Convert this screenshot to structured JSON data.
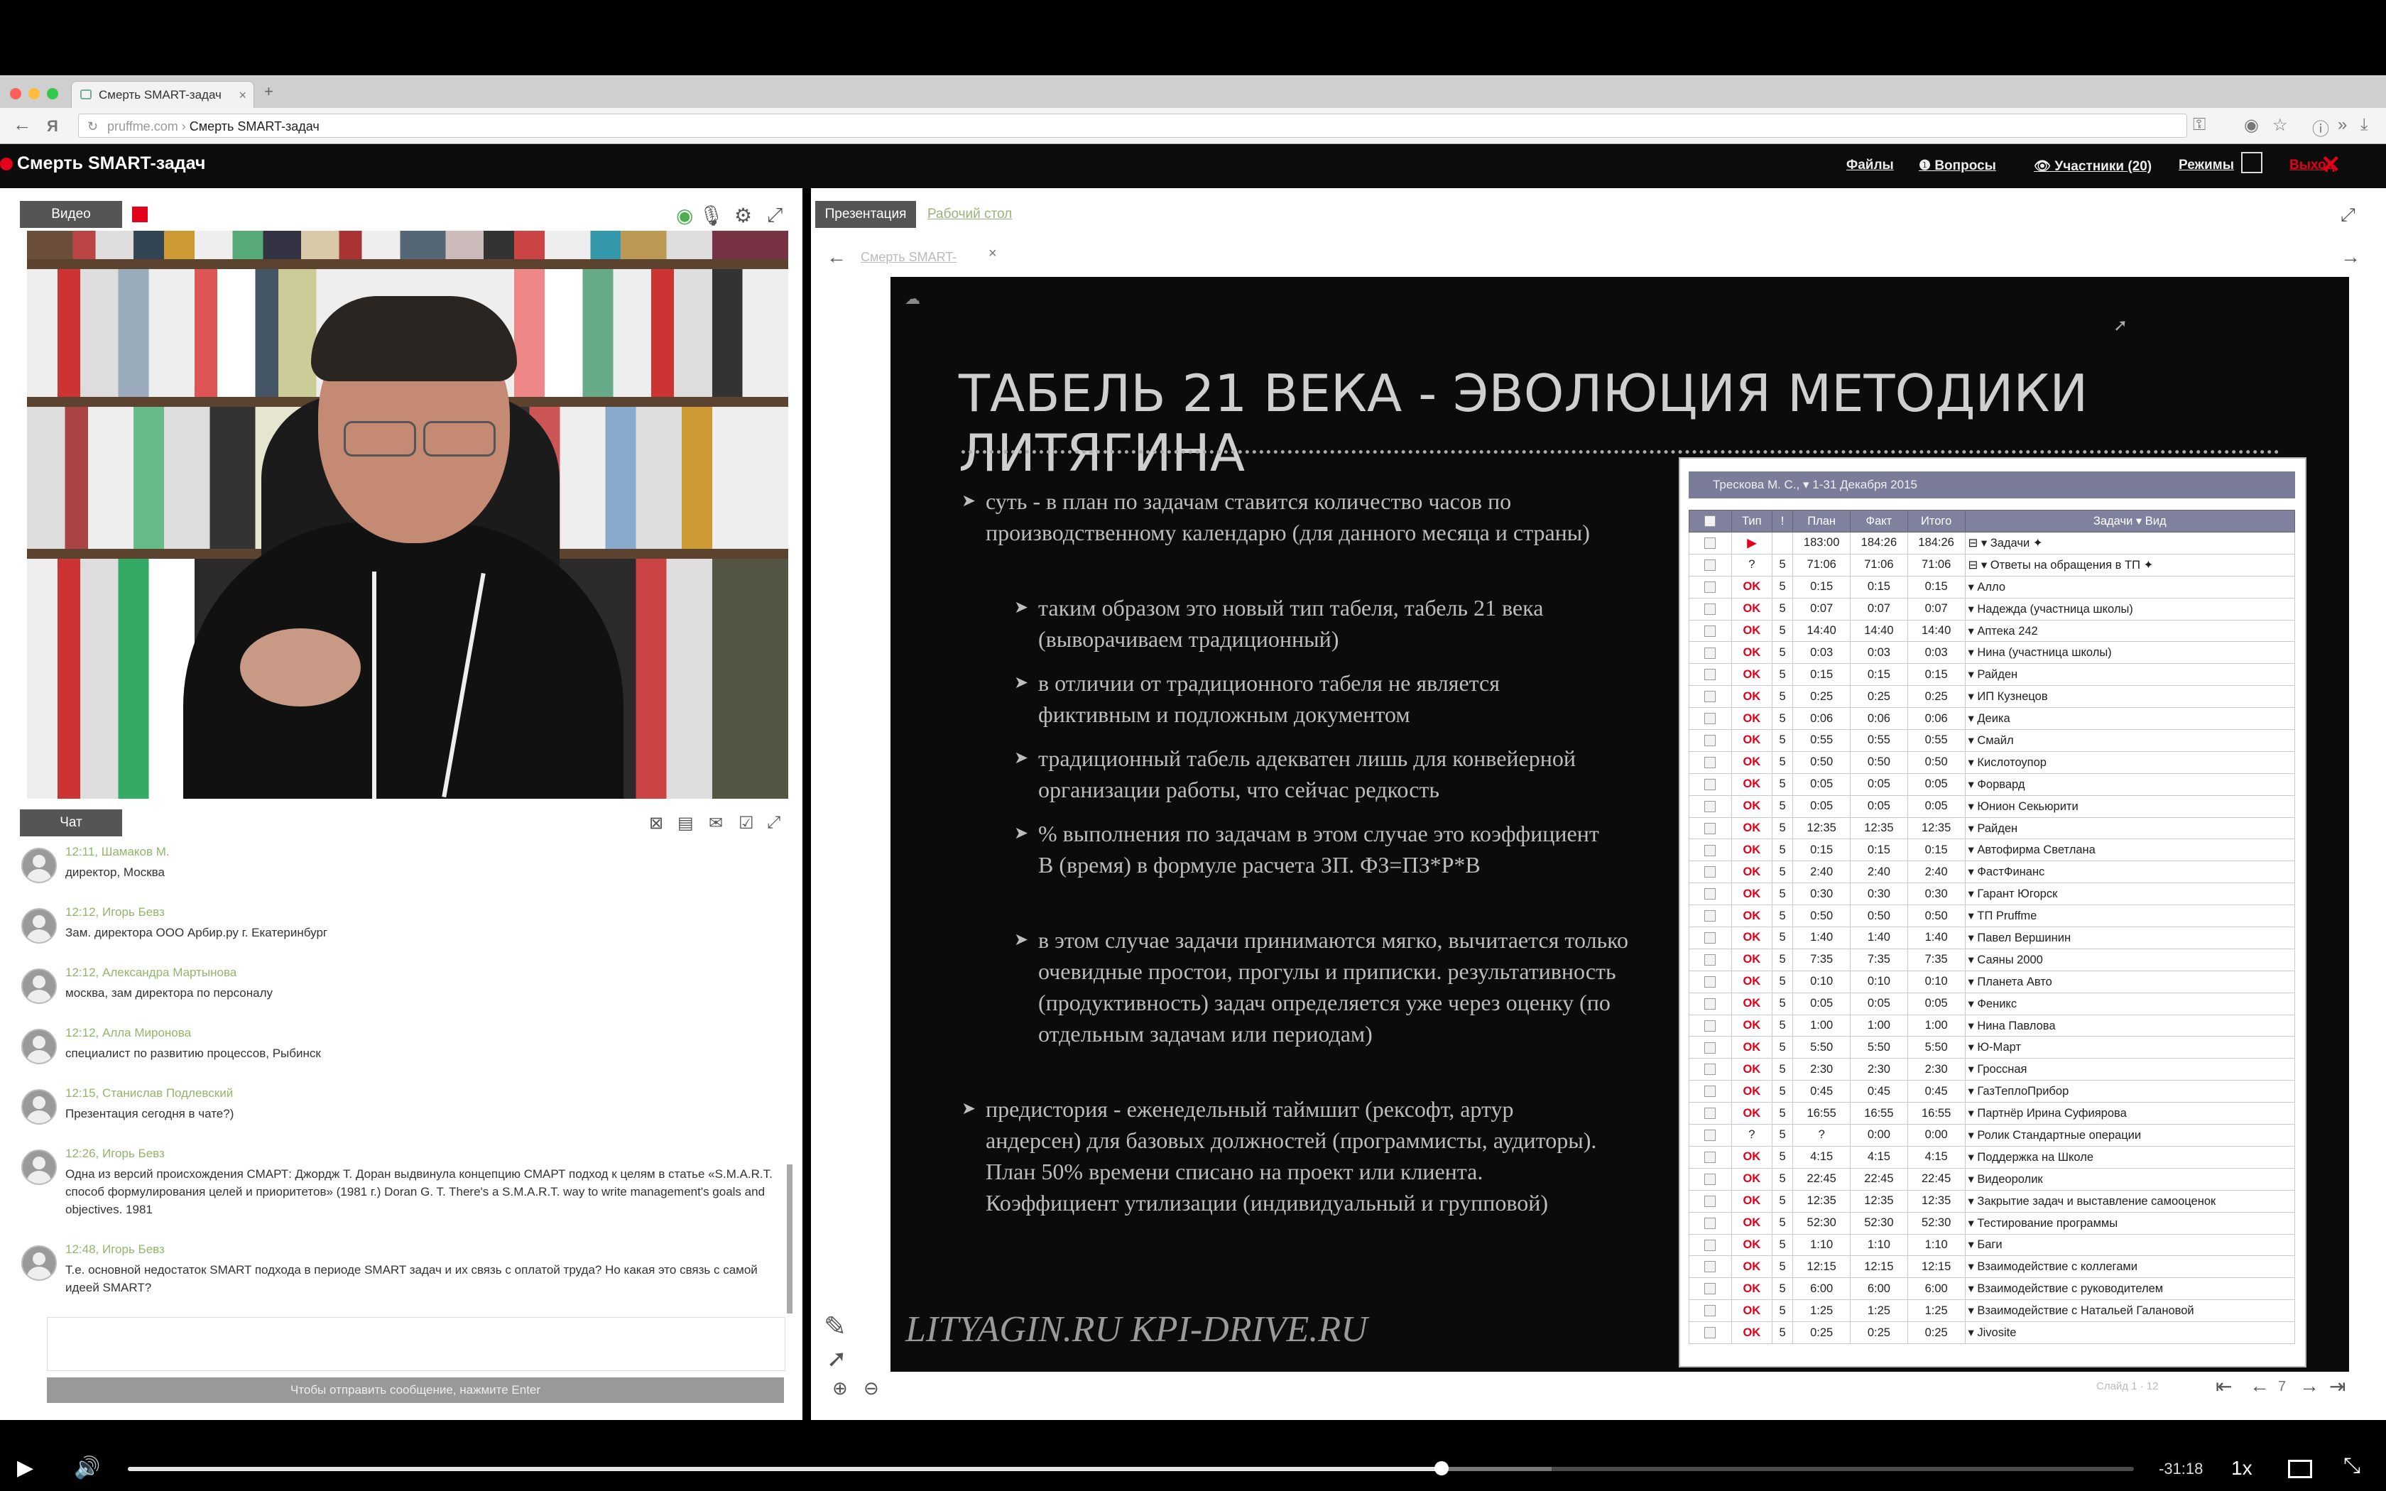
{
  "browser": {
    "tab_title": "Смерть SMART-задач",
    "url_host": "pruffme.com",
    "url_sep": " › ",
    "url_path": "Смерть SMART-задач"
  },
  "app": {
    "title": "Смерть SMART-задач",
    "header_links": [
      "Файлы",
      "Вопросы",
      "Участники (20)",
      "Режимы"
    ],
    "leave_label": "Выход"
  },
  "left": {
    "video_tab": "Видео",
    "chat_tab": "Чат",
    "messages": [
      {
        "time": "12:11",
        "author": "Шамаков М.",
        "text": "директор, Москва"
      },
      {
        "time": "12:12",
        "author": "Игорь Бевз",
        "text": "Зам. директора ООО Арбир.ру г. Екатеринбург"
      },
      {
        "time": "12:12",
        "author": "Александра Мартынова",
        "text": "москва, зам директора по персоналу"
      },
      {
        "time": "12:12",
        "author": "Алла Миронова",
        "text": "специалист по развитию процессов, Рыбинск"
      },
      {
        "time": "12:15",
        "author": "Станислав Подлевский",
        "text": "Презентация сегодня в чате?)"
      },
      {
        "time": "12:26",
        "author": "Игорь Бевз",
        "text": "Одна из версий происхождения СМАРТ: Джордж Т. Доран выдвинула концепцию СМАРТ подход к целям в статье «S.M.A.R.T. способ формулирования целей и приоритетов» (1981 г.) Doran G. T. There's a S.M.A.R.T. way to write management's goals and objectives. 1981"
      },
      {
        "time": "12:48",
        "author": "Игорь Бевз",
        "text": "Т.е. основной недостаток SMART подхода в периоде SMART задач и их связь с оплатой труда? Но какая это связь с самой идеей SMART?"
      }
    ],
    "send_hint": "Чтобы отправить сообщение, нажмите Enter"
  },
  "right": {
    "tab_presentation": "Презентация",
    "tab_desktop": "Рабочий стол",
    "doc_tab": "Смерть SMART-",
    "slide_counter": "Слайд 1 · 12",
    "page_num": "7"
  },
  "slide": {
    "title": "ТАБЕЛЬ 21 ВЕКА - ЭВОЛЮЦИЯ МЕТОДИКИ ЛИТЯГИНА",
    "bullet1": "суть - в план по задачам ставится количество часов по производственному календарю (для данного месяца и страны)",
    "sub1": "таким образом это новый тип табеля, табель 21 века (выворачиваем традиционный)",
    "sub2": "в отличии от традиционного табеля не является фиктивным и подложным документом",
    "sub3": "традиционный табель адекватен лишь для конвейерной организации работы, что сейчас редкость",
    "sub4": "% выполнения по задачам в этом случае это коэффициент В (время) в формуле расчета ЗП. ФЗ=ПЗ*Р*В",
    "sub5": "в этом случае задачи принимаются мягко, вычитается только очевидные простои, прогулы и приписки. результативность (продуктивность) задач определяется уже через оценку (по отдельным задачам или периодам)",
    "bullet2": "предистория - еженедельный таймшит (рексофт, артур андерсен) для базовых должностей (программисты, аудиторы). План 50% времени списано на проект или клиента. Коэффициент утилизации (индивидуальный и групповой)",
    "footer": "LITYAGIN.RU  KPI-DRIVE.RU",
    "table": {
      "header": "Трескова М. С.,  ▾  1-31 Декабря 2015",
      "columns": [
        "",
        "Тип",
        "!",
        "План",
        "Факт",
        "Итого",
        "Задачи  ▾ Вид"
      ],
      "rows": [
        {
          "type": "▶",
          "imp": "",
          "plan": "183:00",
          "fact": "184:26",
          "total": "184:26",
          "name": "⊟ ▾ Задачи ✦"
        },
        {
          "type": "?",
          "imp": "5",
          "plan": "71:06",
          "fact": "71:06",
          "total": "71:06",
          "name": "⊟ ▾ Ответы на обращения в ТП ✦"
        },
        {
          "type": "OK",
          "imp": "5",
          "plan": "0:15",
          "fact": "0:15",
          "total": "0:15",
          "name": "▾ Алло"
        },
        {
          "type": "OK",
          "imp": "5",
          "plan": "0:07",
          "fact": "0:07",
          "total": "0:07",
          "name": "▾ Надежда (участница школы)"
        },
        {
          "type": "OK",
          "imp": "5",
          "plan": "14:40",
          "fact": "14:40",
          "total": "14:40",
          "name": "▾ Аптека 242"
        },
        {
          "type": "OK",
          "imp": "5",
          "plan": "0:03",
          "fact": "0:03",
          "total": "0:03",
          "name": "▾ Нина (участница школы)"
        },
        {
          "type": "OK",
          "imp": "5",
          "plan": "0:15",
          "fact": "0:15",
          "total": "0:15",
          "name": "▾ Райден"
        },
        {
          "type": "OK",
          "imp": "5",
          "plan": "0:25",
          "fact": "0:25",
          "total": "0:25",
          "name": "▾ ИП Кузнецов"
        },
        {
          "type": "OK",
          "imp": "5",
          "plan": "0:06",
          "fact": "0:06",
          "total": "0:06",
          "name": "▾ Деика"
        },
        {
          "type": "OK",
          "imp": "5",
          "plan": "0:55",
          "fact": "0:55",
          "total": "0:55",
          "name": "▾ Смайл"
        },
        {
          "type": "OK",
          "imp": "5",
          "plan": "0:50",
          "fact": "0:50",
          "total": "0:50",
          "name": "▾ Кислотоупор"
        },
        {
          "type": "OK",
          "imp": "5",
          "plan": "0:05",
          "fact": "0:05",
          "total": "0:05",
          "name": "▾ Форвард"
        },
        {
          "type": "OK",
          "imp": "5",
          "plan": "0:05",
          "fact": "0:05",
          "total": "0:05",
          "name": "▾ Юнион Секьюрити"
        },
        {
          "type": "OK",
          "imp": "5",
          "plan": "12:35",
          "fact": "12:35",
          "total": "12:35",
          "name": "▾ Райден"
        },
        {
          "type": "OK",
          "imp": "5",
          "plan": "0:15",
          "fact": "0:15",
          "total": "0:15",
          "name": "▾ Автофирма Светлана"
        },
        {
          "type": "OK",
          "imp": "5",
          "plan": "2:40",
          "fact": "2:40",
          "total": "2:40",
          "name": "▾ ФастФинанс"
        },
        {
          "type": "OK",
          "imp": "5",
          "plan": "0:30",
          "fact": "0:30",
          "total": "0:30",
          "name": "▾ Гарант Югорск"
        },
        {
          "type": "OK",
          "imp": "5",
          "plan": "0:50",
          "fact": "0:50",
          "total": "0:50",
          "name": "▾ ТП Pruffme"
        },
        {
          "type": "OK",
          "imp": "5",
          "plan": "1:40",
          "fact": "1:40",
          "total": "1:40",
          "name": "▾ Павел Вершинин"
        },
        {
          "type": "OK",
          "imp": "5",
          "plan": "7:35",
          "fact": "7:35",
          "total": "7:35",
          "name": "▾ Саяны 2000"
        },
        {
          "type": "OK",
          "imp": "5",
          "plan": "0:10",
          "fact": "0:10",
          "total": "0:10",
          "name": "▾ Планета Авто"
        },
        {
          "type": "OK",
          "imp": "5",
          "plan": "0:05",
          "fact": "0:05",
          "total": "0:05",
          "name": "▾ Феникс"
        },
        {
          "type": "OK",
          "imp": "5",
          "plan": "1:00",
          "fact": "1:00",
          "total": "1:00",
          "name": "▾ Нина Павлова"
        },
        {
          "type": "OK",
          "imp": "5",
          "plan": "5:50",
          "fact": "5:50",
          "total": "5:50",
          "name": "▾ Ю-Март"
        },
        {
          "type": "OK",
          "imp": "5",
          "plan": "2:30",
          "fact": "2:30",
          "total": "2:30",
          "name": "▾ Гроссная"
        },
        {
          "type": "OK",
          "imp": "5",
          "plan": "0:45",
          "fact": "0:45",
          "total": "0:45",
          "name": "▾ ГазТеплоПрибор"
        },
        {
          "type": "OK",
          "imp": "5",
          "plan": "16:55",
          "fact": "16:55",
          "total": "16:55",
          "name": "▾ Партнёр Ирина Суфиярова"
        },
        {
          "type": "?",
          "imp": "5",
          "plan": "?",
          "fact": "0:00",
          "total": "0:00",
          "name": "▾ Ролик Стандартные операции"
        },
        {
          "type": "OK",
          "imp": "5",
          "plan": "4:15",
          "fact": "4:15",
          "total": "4:15",
          "name": "▾ Поддержка на Школе"
        },
        {
          "type": "OK",
          "imp": "5",
          "plan": "22:45",
          "fact": "22:45",
          "total": "22:45",
          "name": "▾ Видеоролик"
        },
        {
          "type": "OK",
          "imp": "5",
          "plan": "12:35",
          "fact": "12:35",
          "total": "12:35",
          "name": "▾ Закрытие задач и выставление самооценок"
        },
        {
          "type": "OK",
          "imp": "5",
          "plan": "52:30",
          "fact": "52:30",
          "total": "52:30",
          "name": "▾ Тестирование программы"
        },
        {
          "type": "OK",
          "imp": "5",
          "plan": "1:10",
          "fact": "1:10",
          "total": "1:10",
          "name": "▾ Баги"
        },
        {
          "type": "OK",
          "imp": "5",
          "plan": "12:15",
          "fact": "12:15",
          "total": "12:15",
          "name": "▾ Взаимодействие с коллегами"
        },
        {
          "type": "OK",
          "imp": "5",
          "plan": "6:00",
          "fact": "6:00",
          "total": "6:00",
          "name": "▾ Взаимодействие с руководителем"
        },
        {
          "type": "OK",
          "imp": "5",
          "plan": "1:25",
          "fact": "1:25",
          "total": "1:25",
          "name": "▾ Взаимодействие с Натальей Галановой"
        },
        {
          "type": "OK",
          "imp": "5",
          "plan": "0:25",
          "fact": "0:25",
          "total": "0:25",
          "name": "▾ Jivosite"
        }
      ]
    }
  },
  "player": {
    "time_remaining": "-31:18",
    "speed": "1x",
    "progress_fraction": 0.655
  },
  "colors": {
    "accent_red": "#e2001a",
    "chat_meta_green": "#93b56a",
    "table_header": "#7f819e"
  }
}
